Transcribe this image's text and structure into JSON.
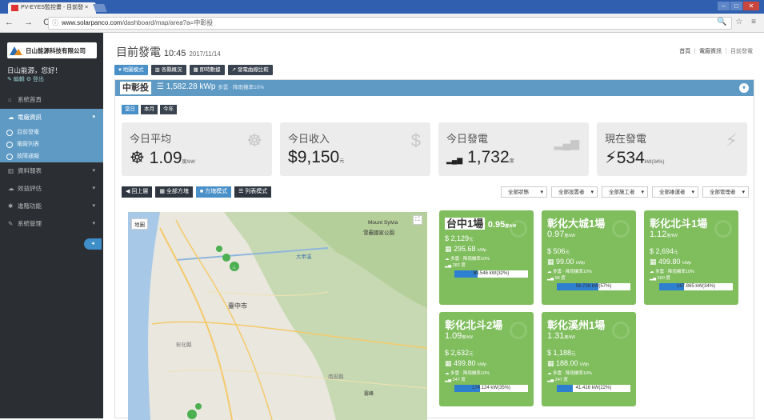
{
  "browser": {
    "tab_title": "PV-EYES監控畫 - 目前發 ×",
    "tab_close": "×",
    "url_host": "www.solarpanco.com",
    "url_path": "/dashboard/map/area?a=中彰投",
    "nav": "← → C ⌂",
    "info": "ⓘ",
    "tools": "🔍 ☆ ≡"
  },
  "sidebar": {
    "company": "日山能源科技有限公司",
    "greeting": "日山能源，您好！",
    "user_links": "✎ 編輯 ⚙ 登出",
    "menu": [
      {
        "icon": "⌂",
        "label": "系統首頁"
      },
      {
        "icon": "☁",
        "label": "電廠資訊",
        "caret": "▾"
      },
      {
        "icon": "▥",
        "label": "資料報表",
        "caret": "▾"
      },
      {
        "icon": "☁",
        "label": "效益評估",
        "caret": "▾"
      },
      {
        "icon": "✱",
        "label": "進階功能",
        "caret": "▾"
      },
      {
        "icon": "✎",
        "label": "系統管理",
        "caret": "▾"
      }
    ],
    "submenu": [
      "目前發電",
      "電廠列表",
      "故障通報"
    ],
    "collapse": "◂"
  },
  "header": {
    "title": "目前發電",
    "time": "10:45",
    "date": "2017/11/14",
    "breadcrumbs": [
      "首頁",
      "電廠資訊",
      "目前發電"
    ]
  },
  "view_tabs": [
    "♥ 地圖模式",
    "▥ 各縣概況",
    "▦ 即時數據",
    "↗ 發電曲線比較"
  ],
  "region": {
    "name": "中彰投",
    "capacity": "1,582.28 kWp",
    "weather": "多雲 · 降雨機率10%",
    "toggle": "▾"
  },
  "periods": [
    "當日",
    "本月",
    "今年"
  ],
  "stats": [
    {
      "label": "今日平均",
      "prefix": "☸",
      "value": "1.09",
      "unit": "度/kW",
      "icon": "☸"
    },
    {
      "label": "今日收入",
      "prefix": "$",
      "value": "9,150",
      "unit": "元",
      "icon": "$"
    },
    {
      "label": "今日發電",
      "prefix": "▂▄▆",
      "value": "1,732",
      "unit": "度",
      "icon": "▂▄▆"
    },
    {
      "label": "現在發電",
      "prefix": "⚡",
      "value": "534",
      "unit": "kW(34%)",
      "icon": "⚡"
    }
  ],
  "toolbar": [
    "◀ 回上層",
    "▦ 全部方塊",
    "■ 方塊模式",
    "☰ 列表模式"
  ],
  "filters": [
    "全部狀態",
    "全部設置者",
    "全部施工者",
    "全部維運者",
    "全部管理者"
  ],
  "map": {
    "type_label": "地圖",
    "fullscreen": "⛶",
    "labels": [
      "Mount Sylvia",
      "雪霸國家公園",
      "大甲溪",
      "臺中市",
      "彰化縣",
      "南投縣",
      "霧峰",
      "鹿港",
      "埔里"
    ],
    "colors": {
      "land": "#e9e7de",
      "mountain": "#c7d9b2",
      "water": "#a8c8e8",
      "road": "#f5c96a",
      "pin": "#4caf50"
    }
  },
  "plants": [
    {
      "name": "台中1場",
      "efficiency": "0.95",
      "eff_unit": "度/kW",
      "income": "2,129",
      "capacity": "295.68",
      "cap_unit": "kWp",
      "weather": "多雲 · 降雨機率10%",
      "energy": "282 度",
      "power": "93.546 kW(32%)",
      "power_fraction": 0.32
    },
    {
      "name": "彰化大城1場",
      "efficiency": "0.97",
      "eff_unit": "度/kW",
      "income": "506",
      "capacity": "99.00",
      "cap_unit": "kWp",
      "weather": "多雲 · 降雨機率10%",
      "energy": "96 度",
      "power": "56.728 kW(57%)",
      "power_fraction": 0.57
    },
    {
      "name": "彰化北斗1場",
      "efficiency": "1.12",
      "eff_unit": "度/kW",
      "income": "2,694",
      "capacity": "499.80",
      "cap_unit": "kWp",
      "weather": "多雲 · 降雨機率10%",
      "energy": "560 度",
      "power": "167.865 kW(34%)",
      "power_fraction": 0.34
    },
    {
      "name": "彰化北斗2場",
      "efficiency": "1.09",
      "eff_unit": "度/kW",
      "income": "2,632",
      "capacity": "499.80",
      "cap_unit": "kWp",
      "weather": "多雲 · 降雨機率10%",
      "energy": "547 度",
      "power": "174.124 kW(35%)",
      "power_fraction": 0.35
    },
    {
      "name": "彰化溪州1場",
      "efficiency": "1.31",
      "eff_unit": "度/kW",
      "income": "1,188",
      "capacity": "188.00",
      "cap_unit": "kWp",
      "weather": "多雲 · 降雨機率10%",
      "energy": "247 度",
      "power": "41.416 kW(22%)",
      "power_fraction": 0.22
    }
  ]
}
